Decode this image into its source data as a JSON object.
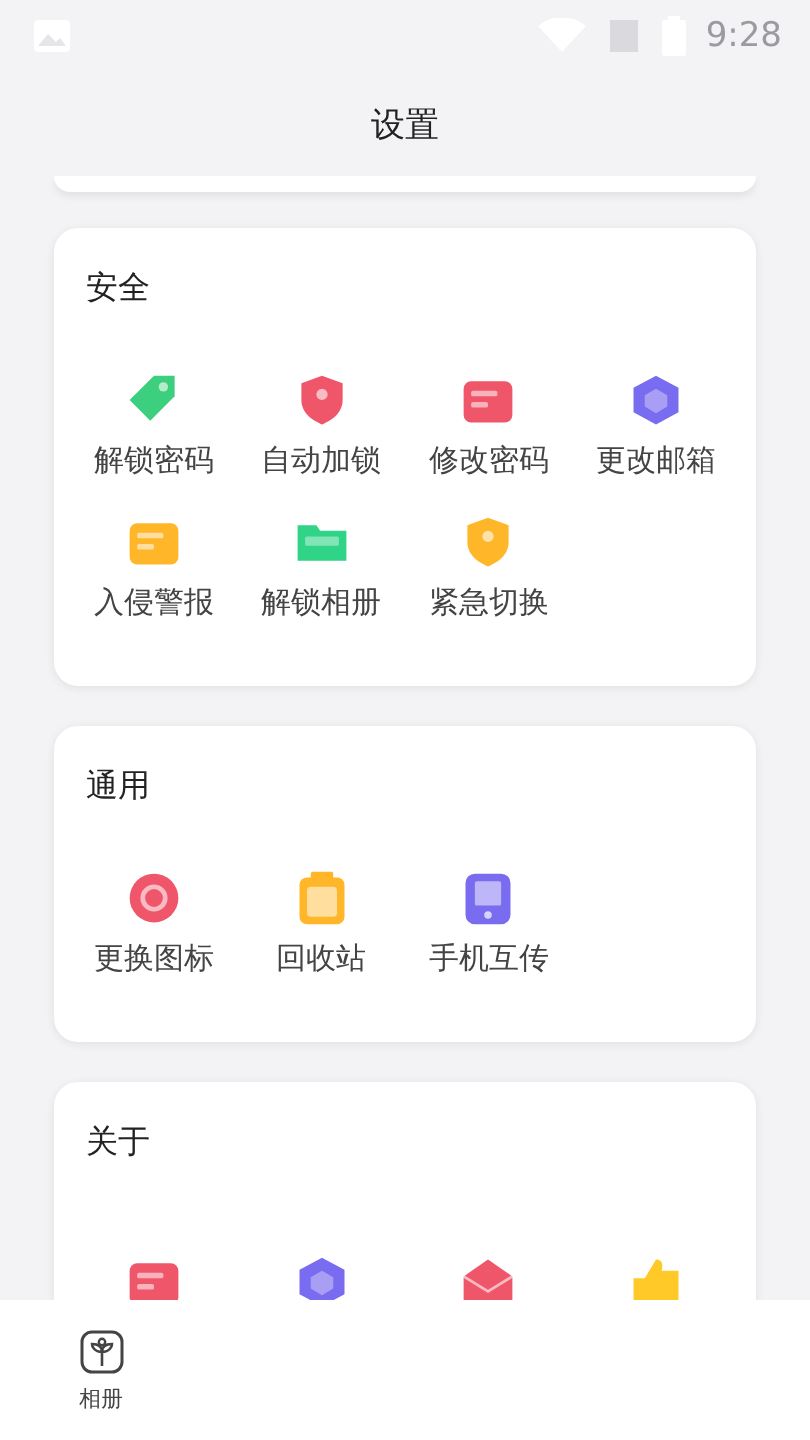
{
  "status_bar": {
    "time": "9:28"
  },
  "header": {
    "title": "设置"
  },
  "sections": [
    {
      "title": "安全",
      "items": [
        {
          "label": "解锁密码"
        },
        {
          "label": "自动加锁"
        },
        {
          "label": "修改密码"
        },
        {
          "label": "更改邮箱"
        },
        {
          "label": "入侵警报"
        },
        {
          "label": "解锁相册"
        },
        {
          "label": "紧急切换"
        }
      ]
    },
    {
      "title": "通用",
      "items": [
        {
          "label": "更换图标"
        },
        {
          "label": "回收站"
        },
        {
          "label": "手机互传"
        }
      ]
    },
    {
      "title": "关于",
      "items": [
        {
          "kind": "icon-only"
        },
        {
          "kind": "icon-only"
        },
        {
          "kind": "icon-only"
        },
        {
          "kind": "icon-only"
        }
      ]
    }
  ],
  "bottom_nav": [
    {
      "label": "相册",
      "selected": false
    }
  ]
}
